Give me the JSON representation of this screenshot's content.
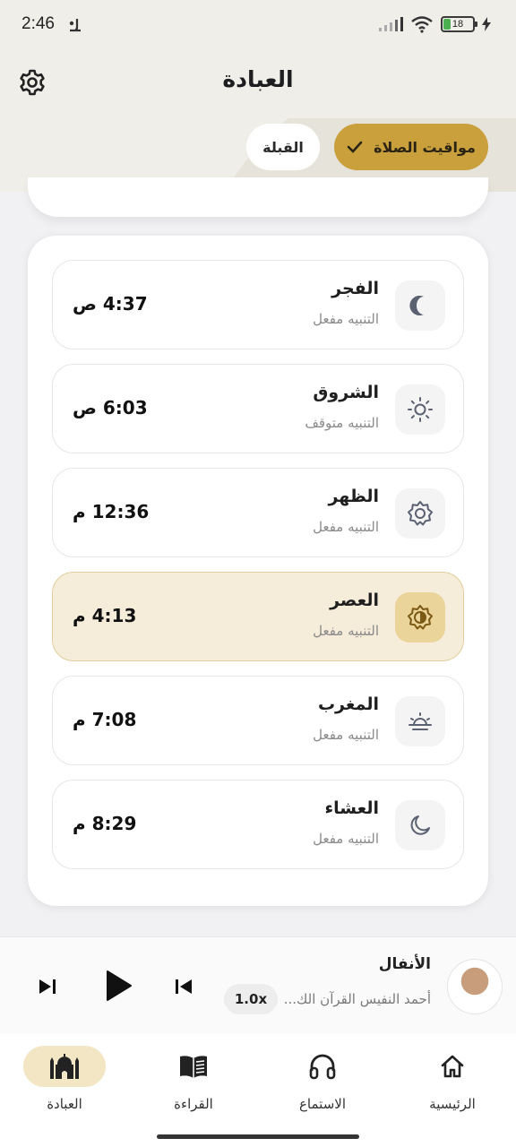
{
  "status_bar": {
    "time": "2:46",
    "battery": "18"
  },
  "header": {
    "title": "العبادة"
  },
  "tabs": [
    {
      "label": "مواقيت الصلاة",
      "selected": true
    },
    {
      "label": "القبلة",
      "selected": false
    }
  ],
  "prayers": [
    {
      "name": "الفجر",
      "status": "التنبيه مفعل",
      "time": "4:37 ص",
      "icon": "moon-icon",
      "active": false
    },
    {
      "name": "الشروق",
      "status": "التنبيه متوقف",
      "time": "6:03 ص",
      "icon": "sun-icon",
      "active": false
    },
    {
      "name": "الظهر",
      "status": "التنبيه مفعل",
      "time": "12:36 م",
      "icon": "sun-gear-icon",
      "active": false
    },
    {
      "name": "العصر",
      "status": "التنبيه مفعل",
      "time": "4:13 م",
      "icon": "half-sun-icon",
      "active": true
    },
    {
      "name": "المغرب",
      "status": "التنبيه مفعل",
      "time": "7:08 م",
      "icon": "sunset-icon",
      "active": false
    },
    {
      "name": "العشاء",
      "status": "التنبيه مفعل",
      "time": "8:29 م",
      "icon": "crescent-icon",
      "active": false
    }
  ],
  "player": {
    "title": "الأنفال",
    "artist": "أحمد النفيس القرآن الك...",
    "speed": "1.0x"
  },
  "nav": [
    {
      "label": "الرئيسية",
      "icon": "home-icon",
      "active": false
    },
    {
      "label": "الاستماع",
      "icon": "headphones-icon",
      "active": false
    },
    {
      "label": "القراءة",
      "icon": "book-icon",
      "active": false
    },
    {
      "label": "العبادة",
      "icon": "mosque-icon",
      "active": true
    }
  ],
  "colors": {
    "accent": "#c9a03c",
    "active_row_bg": "#f6ecda",
    "header_bg": "#efeee9"
  }
}
